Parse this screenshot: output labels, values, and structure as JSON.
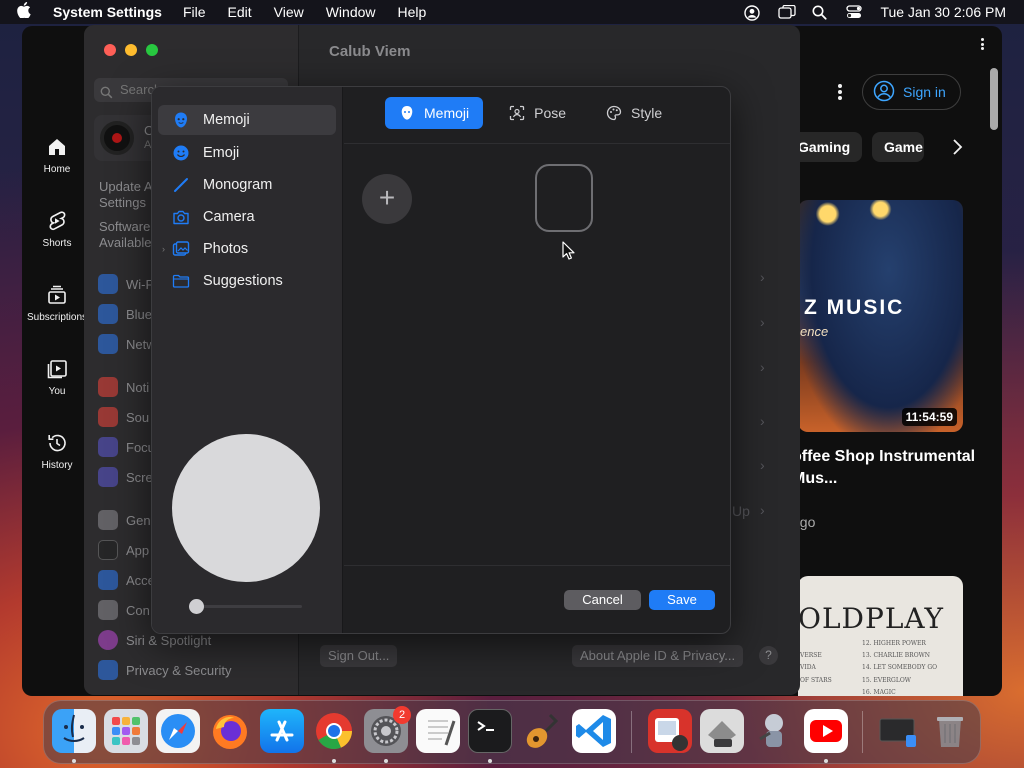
{
  "menubar": {
    "app_name": "System Settings",
    "menus": [
      "File",
      "Edit",
      "View",
      "Window",
      "Help"
    ],
    "datetime": "Tue Jan 30  2:06 PM"
  },
  "youtube": {
    "sidebar": [
      {
        "label": "Home",
        "icon": "home-icon"
      },
      {
        "label": "Shorts",
        "icon": "shorts-icon"
      },
      {
        "label": "Subscriptions",
        "icon": "subscriptions-icon"
      },
      {
        "label": "You",
        "icon": "you-icon"
      },
      {
        "label": "History",
        "icon": "history-icon"
      }
    ],
    "sign_in": "Sign in",
    "chips": [
      "Gaming",
      "Game"
    ],
    "video1": {
      "thumb_text": "Z MUSIC",
      "thumb_subtext": "ence",
      "duration": "11:54:59",
      "title": "offee Shop Instrumental Mus...",
      "meta": "ago"
    },
    "video2": {
      "thumb_text": "OLDPLAY",
      "tracks": [
        "12. HIGHER POWER",
        "13. CHARLIE BROWN",
        "14. LET SOMEBODY GO",
        "15. EVERGLOW",
        "16. MAGIC"
      ],
      "tracks_left": [
        "VERSE",
        "VIDA",
        "OF STARS"
      ]
    }
  },
  "settings": {
    "window_title": "Calub Viem",
    "search_placeholder": "Search",
    "account_initial": "C",
    "account_sub": "A",
    "update_text": [
      "Update A",
      "Settings"
    ],
    "software_text": [
      "Software",
      "Available"
    ],
    "sidebar_groups": [
      [
        {
          "label": "Wi-Fi",
          "color": "#2d7cf6"
        },
        {
          "label": "Blue",
          "color": "#2d7cf6"
        },
        {
          "label": "Netw",
          "color": "#2d7cf6"
        }
      ],
      [
        {
          "label": "Noti",
          "color": "#f0463c"
        },
        {
          "label": "Sou",
          "color": "#f0463c"
        },
        {
          "label": "Focu",
          "color": "#5d5ad6"
        },
        {
          "label": "Scre",
          "color": "#5d5ad6"
        }
      ],
      [
        {
          "label": "Gen",
          "color": "#8e8e93"
        },
        {
          "label": "App",
          "color": "#8e8e93"
        },
        {
          "label": "Acce",
          "color": "#2d7cf6"
        },
        {
          "label": "Con",
          "color": "#8e8e93"
        },
        {
          "label": "Siri & Spotlight",
          "color": "#c04bd8"
        },
        {
          "label": "Privacy & Security",
          "color": "#2d7cf6"
        }
      ]
    ],
    "up_label": "Up",
    "sign_out": "Sign Out...",
    "about": "About Apple ID & Privacy...",
    "help": "?"
  },
  "memoji_dialog": {
    "sidebar": [
      {
        "label": "Memoji",
        "icon": "memoji-icon"
      },
      {
        "label": "Emoji",
        "icon": "emoji-icon"
      },
      {
        "label": "Monogram",
        "icon": "monogram-icon"
      },
      {
        "label": "Camera",
        "icon": "camera-icon"
      },
      {
        "label": "Photos",
        "icon": "photos-icon"
      },
      {
        "label": "Suggestions",
        "icon": "folder-icon"
      }
    ],
    "selected": "Memoji",
    "tabs": [
      {
        "label": "Memoji",
        "icon": "memoji-icon"
      },
      {
        "label": "Pose",
        "icon": "pose-icon"
      },
      {
        "label": "Style",
        "icon": "palette-icon"
      }
    ],
    "active_tab": "Memoji",
    "add_symbol": "+",
    "cancel": "Cancel",
    "save": "Save",
    "zoom_level": 0.0
  },
  "dock": {
    "apps": [
      "Finder",
      "Launchpad",
      "Safari",
      "Firefox",
      "App Store",
      "Chrome",
      "System Settings",
      "TextEdit",
      "Terminal",
      "GarageBand",
      "VS Code",
      "Photo Booth",
      "Boot Camp Assistant",
      "Automator",
      "YouTube",
      "Downloads",
      "Trash"
    ],
    "settings_badge": "2"
  },
  "colors": {
    "accent": "#1f7cf6",
    "youtube_link": "#3ea6ff",
    "youtube_red": "#ff0000"
  }
}
